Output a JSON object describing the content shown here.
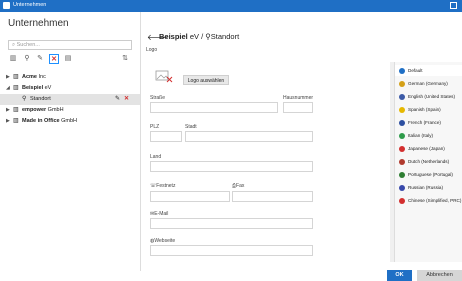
{
  "window": {
    "title": "Unternehmen"
  },
  "left": {
    "heading": "Unternehmen",
    "search_placeholder": "Suchen..."
  },
  "tree": [
    {
      "name": "Acme",
      "suffix": " Inc",
      "expanded": false
    },
    {
      "name": "Beispiel",
      "suffix": " eV",
      "expanded": true
    },
    {
      "name": "Standort",
      "suffix": "",
      "child": true
    },
    {
      "name": "empower",
      "suffix": " GmbH",
      "expanded": false
    },
    {
      "name": "Made in Office",
      "suffix": " GmbH",
      "expanded": false
    }
  ],
  "breadcrumb": {
    "company_bold": "Beispiel",
    "company_rest": " eV /",
    "location": "Standort"
  },
  "form": {
    "logo_label": "Logo",
    "logo_button": "Logo auswählen",
    "street": "Straße",
    "house_number": "Hausnummer",
    "zip": "PLZ",
    "city": "Stadt",
    "country": "Land",
    "phone": "Festnetz",
    "fax": "Fax",
    "email": "E-Mail",
    "website": "Webseite"
  },
  "languages": [
    {
      "label": "Default",
      "flag": "globe",
      "color": "#1f6fc5"
    },
    {
      "label": "German (Germany)",
      "color": "#d4a017"
    },
    {
      "label": "English (United States)",
      "color": "#3c5aa6"
    },
    {
      "label": "Spanish (Spain)",
      "color": "#e6b800"
    },
    {
      "label": "French (France)",
      "color": "#2d4fa0"
    },
    {
      "label": "Italian (Italy)",
      "color": "#2e9b4a"
    },
    {
      "label": "Japanese (Japan)",
      "color": "#d32f2f"
    },
    {
      "label": "Dutch (Netherlands)",
      "color": "#b03a2e"
    },
    {
      "label": "Portuguese (Portugal)",
      "color": "#2e7d32"
    },
    {
      "label": "Russian (Russia)",
      "color": "#3949ab"
    },
    {
      "label": "Chinese (Simplified, PRC)",
      "color": "#d32f2f"
    }
  ],
  "buttons": {
    "ok": "OK",
    "cancel": "Abbrechen"
  }
}
